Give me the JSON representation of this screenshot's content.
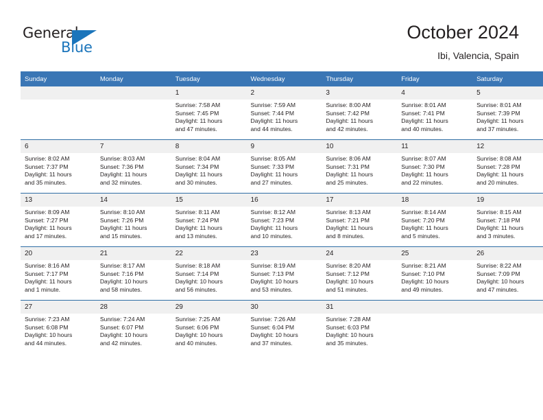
{
  "brand": {
    "name_part1": "General",
    "name_part2": "Blue",
    "logo_icon": "triangle-logo-icon",
    "accent_color": "#1b75bb"
  },
  "header": {
    "title": "October 2024",
    "subtitle": "Ibi, Valencia, Spain"
  },
  "calendar": {
    "header_color": "#3a76b5",
    "weekday_headers": [
      "Sunday",
      "Monday",
      "Tuesday",
      "Wednesday",
      "Thursday",
      "Friday",
      "Saturday"
    ],
    "weeks": [
      [
        {
          "day": "",
          "sunrise": "",
          "sunset": "",
          "daylight_line1": "",
          "daylight_line2": ""
        },
        {
          "day": "",
          "sunrise": "",
          "sunset": "",
          "daylight_line1": "",
          "daylight_line2": ""
        },
        {
          "day": "1",
          "sunrise": "Sunrise: 7:58 AM",
          "sunset": "Sunset: 7:45 PM",
          "daylight_line1": "Daylight: 11 hours",
          "daylight_line2": "and 47 minutes."
        },
        {
          "day": "2",
          "sunrise": "Sunrise: 7:59 AM",
          "sunset": "Sunset: 7:44 PM",
          "daylight_line1": "Daylight: 11 hours",
          "daylight_line2": "and 44 minutes."
        },
        {
          "day": "3",
          "sunrise": "Sunrise: 8:00 AM",
          "sunset": "Sunset: 7:42 PM",
          "daylight_line1": "Daylight: 11 hours",
          "daylight_line2": "and 42 minutes."
        },
        {
          "day": "4",
          "sunrise": "Sunrise: 8:01 AM",
          "sunset": "Sunset: 7:41 PM",
          "daylight_line1": "Daylight: 11 hours",
          "daylight_line2": "and 40 minutes."
        },
        {
          "day": "5",
          "sunrise": "Sunrise: 8:01 AM",
          "sunset": "Sunset: 7:39 PM",
          "daylight_line1": "Daylight: 11 hours",
          "daylight_line2": "and 37 minutes."
        }
      ],
      [
        {
          "day": "6",
          "sunrise": "Sunrise: 8:02 AM",
          "sunset": "Sunset: 7:37 PM",
          "daylight_line1": "Daylight: 11 hours",
          "daylight_line2": "and 35 minutes."
        },
        {
          "day": "7",
          "sunrise": "Sunrise: 8:03 AM",
          "sunset": "Sunset: 7:36 PM",
          "daylight_line1": "Daylight: 11 hours",
          "daylight_line2": "and 32 minutes."
        },
        {
          "day": "8",
          "sunrise": "Sunrise: 8:04 AM",
          "sunset": "Sunset: 7:34 PM",
          "daylight_line1": "Daylight: 11 hours",
          "daylight_line2": "and 30 minutes."
        },
        {
          "day": "9",
          "sunrise": "Sunrise: 8:05 AM",
          "sunset": "Sunset: 7:33 PM",
          "daylight_line1": "Daylight: 11 hours",
          "daylight_line2": "and 27 minutes."
        },
        {
          "day": "10",
          "sunrise": "Sunrise: 8:06 AM",
          "sunset": "Sunset: 7:31 PM",
          "daylight_line1": "Daylight: 11 hours",
          "daylight_line2": "and 25 minutes."
        },
        {
          "day": "11",
          "sunrise": "Sunrise: 8:07 AM",
          "sunset": "Sunset: 7:30 PM",
          "daylight_line1": "Daylight: 11 hours",
          "daylight_line2": "and 22 minutes."
        },
        {
          "day": "12",
          "sunrise": "Sunrise: 8:08 AM",
          "sunset": "Sunset: 7:28 PM",
          "daylight_line1": "Daylight: 11 hours",
          "daylight_line2": "and 20 minutes."
        }
      ],
      [
        {
          "day": "13",
          "sunrise": "Sunrise: 8:09 AM",
          "sunset": "Sunset: 7:27 PM",
          "daylight_line1": "Daylight: 11 hours",
          "daylight_line2": "and 17 minutes."
        },
        {
          "day": "14",
          "sunrise": "Sunrise: 8:10 AM",
          "sunset": "Sunset: 7:26 PM",
          "daylight_line1": "Daylight: 11 hours",
          "daylight_line2": "and 15 minutes."
        },
        {
          "day": "15",
          "sunrise": "Sunrise: 8:11 AM",
          "sunset": "Sunset: 7:24 PM",
          "daylight_line1": "Daylight: 11 hours",
          "daylight_line2": "and 13 minutes."
        },
        {
          "day": "16",
          "sunrise": "Sunrise: 8:12 AM",
          "sunset": "Sunset: 7:23 PM",
          "daylight_line1": "Daylight: 11 hours",
          "daylight_line2": "and 10 minutes."
        },
        {
          "day": "17",
          "sunrise": "Sunrise: 8:13 AM",
          "sunset": "Sunset: 7:21 PM",
          "daylight_line1": "Daylight: 11 hours",
          "daylight_line2": "and 8 minutes."
        },
        {
          "day": "18",
          "sunrise": "Sunrise: 8:14 AM",
          "sunset": "Sunset: 7:20 PM",
          "daylight_line1": "Daylight: 11 hours",
          "daylight_line2": "and 5 minutes."
        },
        {
          "day": "19",
          "sunrise": "Sunrise: 8:15 AM",
          "sunset": "Sunset: 7:18 PM",
          "daylight_line1": "Daylight: 11 hours",
          "daylight_line2": "and 3 minutes."
        }
      ],
      [
        {
          "day": "20",
          "sunrise": "Sunrise: 8:16 AM",
          "sunset": "Sunset: 7:17 PM",
          "daylight_line1": "Daylight: 11 hours",
          "daylight_line2": "and 1 minute."
        },
        {
          "day": "21",
          "sunrise": "Sunrise: 8:17 AM",
          "sunset": "Sunset: 7:16 PM",
          "daylight_line1": "Daylight: 10 hours",
          "daylight_line2": "and 58 minutes."
        },
        {
          "day": "22",
          "sunrise": "Sunrise: 8:18 AM",
          "sunset": "Sunset: 7:14 PM",
          "daylight_line1": "Daylight: 10 hours",
          "daylight_line2": "and 56 minutes."
        },
        {
          "day": "23",
          "sunrise": "Sunrise: 8:19 AM",
          "sunset": "Sunset: 7:13 PM",
          "daylight_line1": "Daylight: 10 hours",
          "daylight_line2": "and 53 minutes."
        },
        {
          "day": "24",
          "sunrise": "Sunrise: 8:20 AM",
          "sunset": "Sunset: 7:12 PM",
          "daylight_line1": "Daylight: 10 hours",
          "daylight_line2": "and 51 minutes."
        },
        {
          "day": "25",
          "sunrise": "Sunrise: 8:21 AM",
          "sunset": "Sunset: 7:10 PM",
          "daylight_line1": "Daylight: 10 hours",
          "daylight_line2": "and 49 minutes."
        },
        {
          "day": "26",
          "sunrise": "Sunrise: 8:22 AM",
          "sunset": "Sunset: 7:09 PM",
          "daylight_line1": "Daylight: 10 hours",
          "daylight_line2": "and 47 minutes."
        }
      ],
      [
        {
          "day": "27",
          "sunrise": "Sunrise: 7:23 AM",
          "sunset": "Sunset: 6:08 PM",
          "daylight_line1": "Daylight: 10 hours",
          "daylight_line2": "and 44 minutes."
        },
        {
          "day": "28",
          "sunrise": "Sunrise: 7:24 AM",
          "sunset": "Sunset: 6:07 PM",
          "daylight_line1": "Daylight: 10 hours",
          "daylight_line2": "and 42 minutes."
        },
        {
          "day": "29",
          "sunrise": "Sunrise: 7:25 AM",
          "sunset": "Sunset: 6:06 PM",
          "daylight_line1": "Daylight: 10 hours",
          "daylight_line2": "and 40 minutes."
        },
        {
          "day": "30",
          "sunrise": "Sunrise: 7:26 AM",
          "sunset": "Sunset: 6:04 PM",
          "daylight_line1": "Daylight: 10 hours",
          "daylight_line2": "and 37 minutes."
        },
        {
          "day": "31",
          "sunrise": "Sunrise: 7:28 AM",
          "sunset": "Sunset: 6:03 PM",
          "daylight_line1": "Daylight: 10 hours",
          "daylight_line2": "and 35 minutes."
        },
        {
          "day": "",
          "sunrise": "",
          "sunset": "",
          "daylight_line1": "",
          "daylight_line2": ""
        },
        {
          "day": "",
          "sunrise": "",
          "sunset": "",
          "daylight_line1": "",
          "daylight_line2": ""
        }
      ]
    ]
  }
}
